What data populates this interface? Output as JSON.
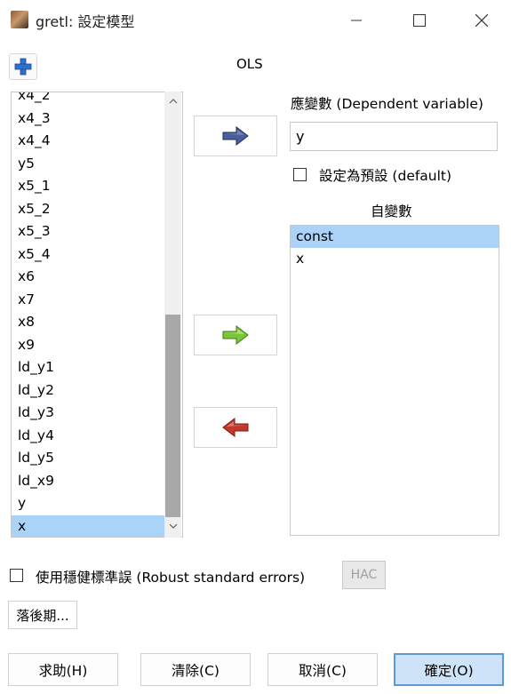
{
  "window": {
    "title": "gretl: 設定模型",
    "controls": [
      "minimize-icon",
      "maximize-icon",
      "close-icon"
    ]
  },
  "toolbar": {
    "add_icon": "plus-icon",
    "model_label": "OLS"
  },
  "variables": {
    "items": [
      "x4_2",
      "x4_3",
      "x4_4",
      "y5",
      "x5_1",
      "x5_2",
      "x5_3",
      "x5_4",
      "x6",
      "x7",
      "x8",
      "x9",
      "ld_y1",
      "ld_y2",
      "ld_y3",
      "ld_y4",
      "ld_y5",
      "ld_x9",
      "y",
      "x"
    ],
    "selected": "x"
  },
  "arrows": {
    "dependent": "right-arrow-icon",
    "add": "right-arrow-icon",
    "remove": "left-arrow-icon"
  },
  "dependent": {
    "label": "應變數 (Dependent variable)",
    "value": "y",
    "default_label": "設定為預設 (default)",
    "default_checked": false
  },
  "independent": {
    "label": "自變數",
    "items": [
      "const",
      "x"
    ],
    "selected": "const"
  },
  "options": {
    "robust_label": "使用穩健標準誤 (Robust standard errors)",
    "robust_checked": false,
    "hac_label": "HAC",
    "lags_label": "落後期..."
  },
  "footer": {
    "help": "求助(H)",
    "clear": "清除(C)",
    "cancel": "取消(C)",
    "ok": "確定(O)"
  },
  "colors": {
    "selection": "#abd3f8",
    "arrow_blue": "#4a5f9a",
    "arrow_green": "#7cc63a",
    "arrow_red": "#c0392b",
    "ok_border": "#5a9ad9"
  }
}
